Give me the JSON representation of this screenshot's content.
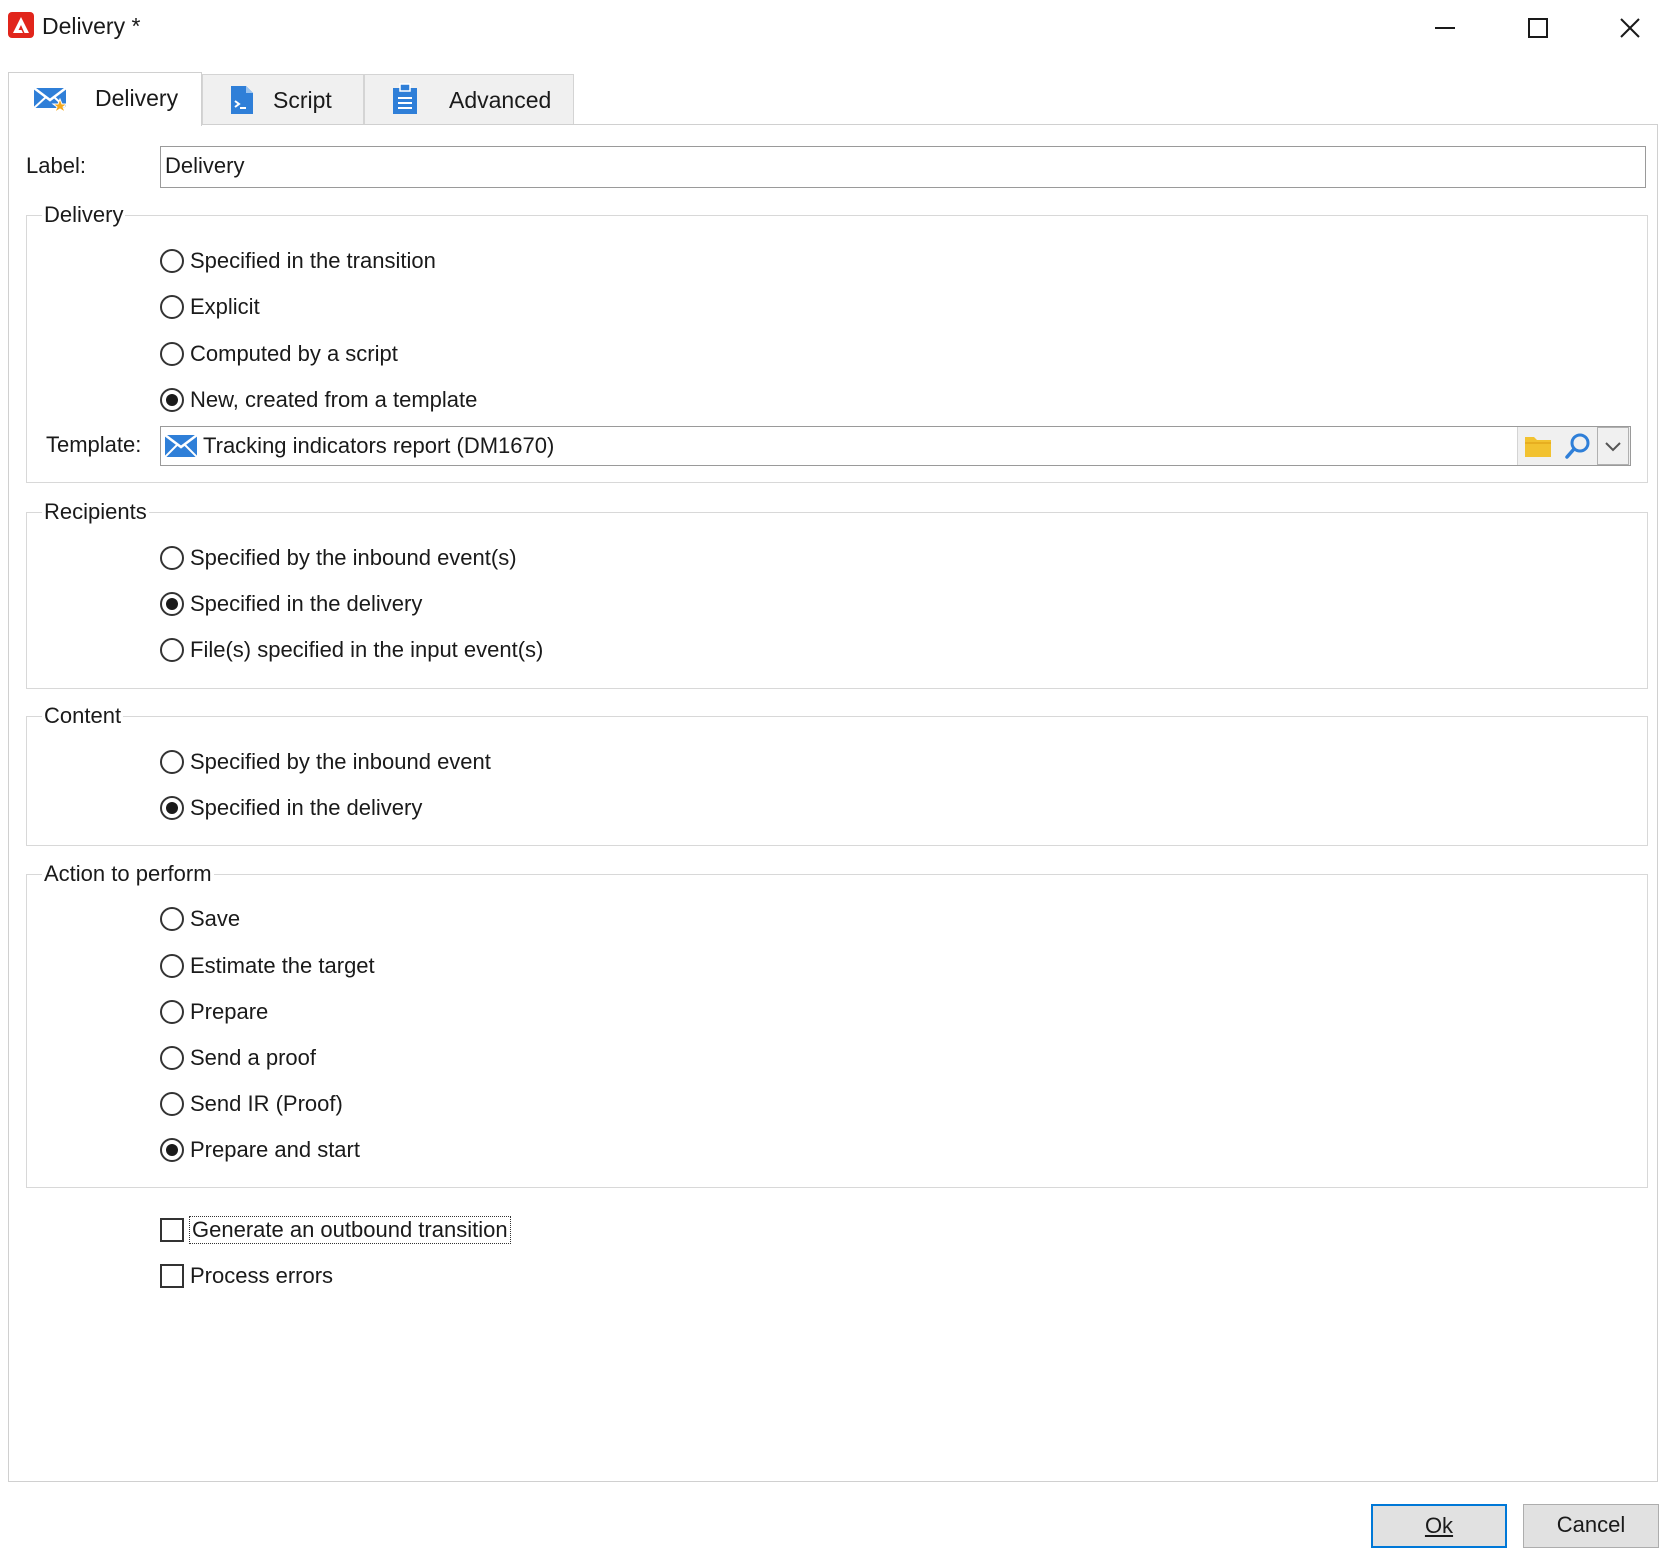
{
  "window": {
    "title": "Delivery *"
  },
  "tabs": [
    {
      "label": "Delivery",
      "icon": "envelope-star-icon",
      "active": true
    },
    {
      "label": "Script",
      "icon": "script-document-icon",
      "active": false
    },
    {
      "label": "Advanced",
      "icon": "clipboard-icon",
      "active": false
    }
  ],
  "label_field": {
    "label": "Label:",
    "value": "Delivery"
  },
  "delivery_group": {
    "title": "Delivery",
    "options": [
      {
        "label": "Specified in the transition",
        "checked": false
      },
      {
        "label": "Explicit",
        "checked": false
      },
      {
        "label": "Computed by a script",
        "checked": false
      },
      {
        "label": "New, created from a template",
        "checked": true
      }
    ],
    "template_label": "Template:",
    "template_value": "Tracking indicators report (DM1670)"
  },
  "recipients_group": {
    "title": "Recipients",
    "options": [
      {
        "label": "Specified by the inbound event(s)",
        "checked": false
      },
      {
        "label": "Specified in the delivery",
        "checked": true
      },
      {
        "label": "File(s) specified in the input event(s)",
        "checked": false
      }
    ]
  },
  "content_group": {
    "title": "Content",
    "options": [
      {
        "label": "Specified by the inbound event",
        "checked": false
      },
      {
        "label": "Specified in the delivery",
        "checked": true
      }
    ]
  },
  "action_group": {
    "title": "Action to perform",
    "options": [
      {
        "label": "Save",
        "checked": false
      },
      {
        "label": "Estimate the target",
        "checked": false
      },
      {
        "label": "Prepare",
        "checked": false
      },
      {
        "label": "Send a proof",
        "checked": false
      },
      {
        "label": "Send IR (Proof)",
        "checked": false
      },
      {
        "label": "Prepare and start",
        "checked": true
      }
    ]
  },
  "checkboxes": [
    {
      "label": "Generate an outbound transition",
      "checked": false
    },
    {
      "label": "Process errors",
      "checked": false
    }
  ],
  "buttons": {
    "ok": "Ok",
    "cancel": "Cancel"
  },
  "colors": {
    "accent": "#0078d7",
    "brand": "#e1251b",
    "folder": "#f2c230",
    "icon_blue": "#2f7fd8"
  }
}
